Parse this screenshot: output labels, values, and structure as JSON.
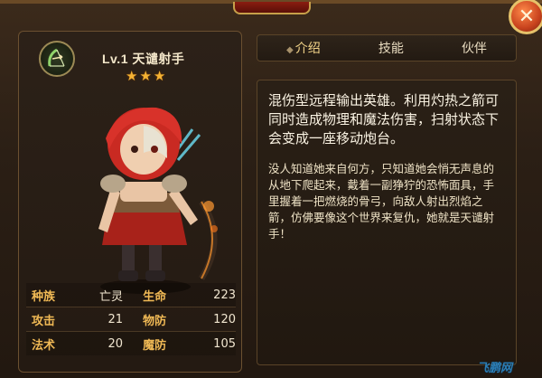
{
  "hero": {
    "title": "Lv.1 天谴射手",
    "stars": [
      "★",
      "★",
      "★"
    ],
    "class_icon": "bow-icon"
  },
  "stats": [
    {
      "label": "种族",
      "value": "亡灵",
      "label2": "生命",
      "value2": "223"
    },
    {
      "label": "攻击",
      "value": "21",
      "label2": "物防",
      "value2": "120"
    },
    {
      "label": "法术",
      "value": "20",
      "label2": "魔防",
      "value2": "105"
    }
  ],
  "tabs": [
    {
      "label": "介绍",
      "active": true
    },
    {
      "label": "技能",
      "active": false
    },
    {
      "label": "伙伴",
      "active": false
    }
  ],
  "description": {
    "summary": "混伤型远程输出英雄。利用灼热之箭可同时造成物理和魔法伤害，扫射状态下会变成一座移动炮台。",
    "lore": "没人知道她来自何方，只知道她会悄无声息的从地下爬起来，戴着一副狰狞的恐怖面具，手里握着一把燃烧的骨弓，向敌人射出烈焰之箭，仿佛要像这个世界来复仇，她就是天谴射手！"
  },
  "close_button": {
    "icon": "close-icon",
    "symbol": "✕"
  },
  "watermark": "飞鹏网",
  "colors": {
    "accent_gold": "#f0b955",
    "star": "#f4b233",
    "close_red": "#c8421d",
    "watermark_blue": "#2c8fd3"
  }
}
